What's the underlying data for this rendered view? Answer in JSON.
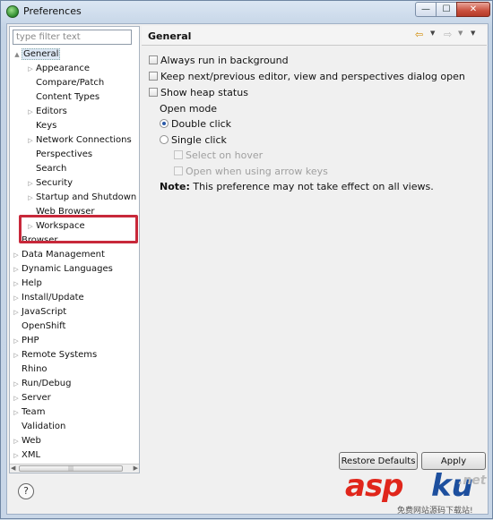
{
  "window": {
    "title": "Preferences",
    "min_glyph": "—",
    "max_glyph": "☐",
    "close_glyph": "✕",
    "icon": "eclipse-icon"
  },
  "filter": {
    "placeholder": "type filter text"
  },
  "tree": {
    "items": [
      {
        "label": "General",
        "arrow": "▲",
        "selected": true
      },
      {
        "label": "Appearance",
        "arrow": "▷"
      },
      {
        "label": "Compare/Patch",
        "arrow": ""
      },
      {
        "label": "Content Types",
        "arrow": ""
      },
      {
        "label": "Editors",
        "arrow": "▷"
      },
      {
        "label": "Keys",
        "arrow": ""
      },
      {
        "label": "Network Connections",
        "arrow": "▷"
      },
      {
        "label": "Perspectives",
        "arrow": ""
      },
      {
        "label": "Search",
        "arrow": ""
      },
      {
        "label": "Security",
        "arrow": "▷"
      },
      {
        "label": "Startup and Shutdown",
        "arrow": "▷"
      },
      {
        "label": "Web Browser",
        "arrow": ""
      },
      {
        "label": "Workspace",
        "arrow": "▷"
      },
      {
        "label": "Browser",
        "arrow": ""
      },
      {
        "label": "Data Management",
        "arrow": "▷"
      },
      {
        "label": "Dynamic Languages",
        "arrow": "▷"
      },
      {
        "label": "Help",
        "arrow": "▷"
      },
      {
        "label": "Install/Update",
        "arrow": "▷"
      },
      {
        "label": "JavaScript",
        "arrow": "▷"
      },
      {
        "label": "OpenShift",
        "arrow": ""
      },
      {
        "label": "PHP",
        "arrow": "▷"
      },
      {
        "label": "Remote Systems",
        "arrow": "▷"
      },
      {
        "label": "Rhino",
        "arrow": ""
      },
      {
        "label": "Run/Debug",
        "arrow": "▷"
      },
      {
        "label": "Server",
        "arrow": "▷"
      },
      {
        "label": "Team",
        "arrow": "▷"
      },
      {
        "label": "Validation",
        "arrow": ""
      },
      {
        "label": "Web",
        "arrow": "▷"
      },
      {
        "label": "XML",
        "arrow": "▷"
      }
    ],
    "scroll_left": "◀",
    "scroll_right": "▶",
    "scroll_grip": "|||"
  },
  "page": {
    "title": "General",
    "nav_back": "⇦",
    "nav_fwd": "⇨",
    "dropdown": "▼",
    "options": {
      "run_in_background": {
        "label": "Always run in background",
        "checked": false
      },
      "keep_next_prev": {
        "label": "Keep next/previous editor, view and perspectives dialog open",
        "checked": false
      },
      "show_heap": {
        "label": "Show heap status",
        "checked": false
      }
    },
    "open_mode": {
      "heading": "Open mode",
      "double_click": "Double click",
      "single_click": "Single click",
      "select_on_hover": "Select on hover",
      "open_arrow_keys": "Open when using arrow keys",
      "selected": "double_click"
    },
    "note_label": "Note:",
    "note_text": " This preference may not take effect on all views.",
    "restore_defaults": "Restore Defaults",
    "apply": "Apply"
  },
  "footer": {
    "help_glyph": "?"
  },
  "watermark": {
    "brand_red": "asp",
    "brand_blue": "ku",
    "brand_suffix": ".net",
    "sub": "免费网站源码下载站!"
  },
  "colors": {
    "highlight_box": "#c8283a",
    "close_button": "#c9503d",
    "selection": "#dde8f5"
  }
}
